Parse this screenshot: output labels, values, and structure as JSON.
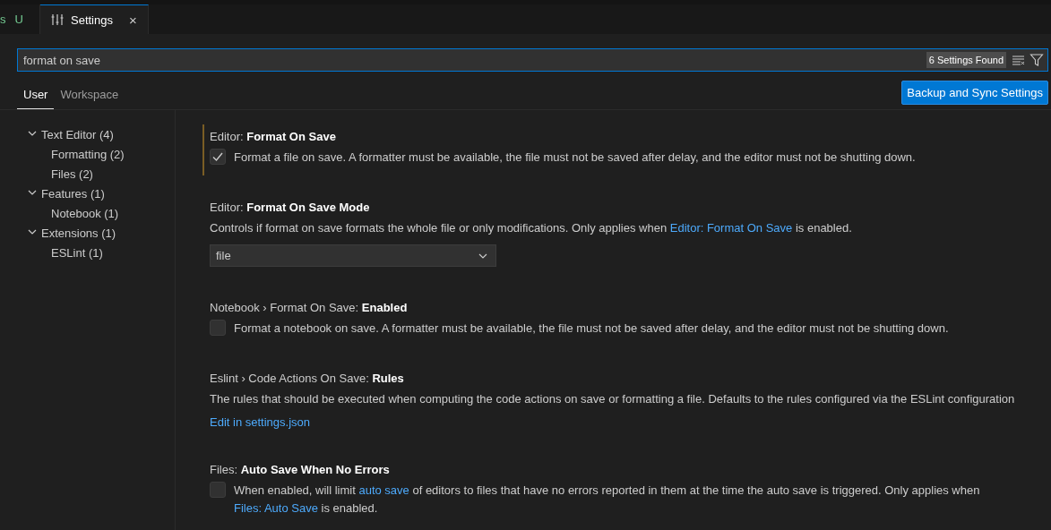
{
  "tabs": [
    {
      "label": "s",
      "badge": "U",
      "selected": false,
      "kind": "file"
    },
    {
      "label": "Settings",
      "close": "×",
      "selected": true,
      "kind": "settings"
    }
  ],
  "search": {
    "value": "format on save",
    "result_count": "6 Settings Found"
  },
  "scope_tabs": [
    {
      "label": "User",
      "selected": true
    },
    {
      "label": "Workspace",
      "selected": false
    }
  ],
  "sync_button": "Backup and Sync Settings",
  "toc": [
    {
      "label": "Text Editor (4)",
      "expanded": true,
      "children": [
        {
          "label": "Formatting (2)"
        },
        {
          "label": "Files (2)"
        }
      ]
    },
    {
      "label": "Features (1)",
      "expanded": true,
      "children": [
        {
          "label": "Notebook (1)"
        }
      ]
    },
    {
      "label": "Extensions (1)",
      "expanded": true,
      "children": [
        {
          "label": "ESLint (1)"
        }
      ]
    }
  ],
  "settings": [
    {
      "kind": "checkbox",
      "category": "Editor: ",
      "name": "Format On Save",
      "focused": true,
      "checked": true,
      "description": [
        {
          "text": "Format a file on save. A formatter must be available, the file must not be saved after delay, and the editor must not be shutting down.",
          "link": false
        }
      ]
    },
    {
      "kind": "dropdown",
      "category": "Editor: ",
      "name": "Format On Save Mode",
      "focused": false,
      "description": [
        {
          "text": "Controls if format on save formats the whole file or only modifications. Only applies when ",
          "link": false
        },
        {
          "text": "Editor: Format On Save",
          "link": true
        },
        {
          "text": " is enabled.",
          "link": false
        }
      ],
      "value": "file"
    },
    {
      "kind": "checkbox",
      "category": "Notebook › Format On Save: ",
      "name": "Enabled",
      "focused": false,
      "checked": false,
      "description": [
        {
          "text": "Format a notebook on save. A formatter must be available, the file must not be saved after delay, and the editor must not be shutting down.",
          "link": false
        }
      ]
    },
    {
      "kind": "json",
      "category": "Eslint › Code Actions On Save: ",
      "name": "Rules",
      "focused": false,
      "description": [
        {
          "text": "The rules that should be executed when computing the code actions on save or formatting a file. Defaults to the rules configured via the ESLint configuration",
          "link": false
        }
      ],
      "action": "Edit in settings.json"
    },
    {
      "kind": "checkbox",
      "category": "Files: ",
      "name": "Auto Save When No Errors",
      "focused": false,
      "checked": false,
      "description": [
        {
          "text": "When enabled, will limit ",
          "link": false
        },
        {
          "text": "auto save",
          "link": true
        },
        {
          "text": " of editors to files that have no errors reported in them at the time the auto save is triggered. Only applies when ",
          "link": false
        },
        {
          "text": "Files: Auto Save",
          "link": true
        },
        {
          "text": " is enabled.",
          "link": false
        }
      ]
    }
  ]
}
